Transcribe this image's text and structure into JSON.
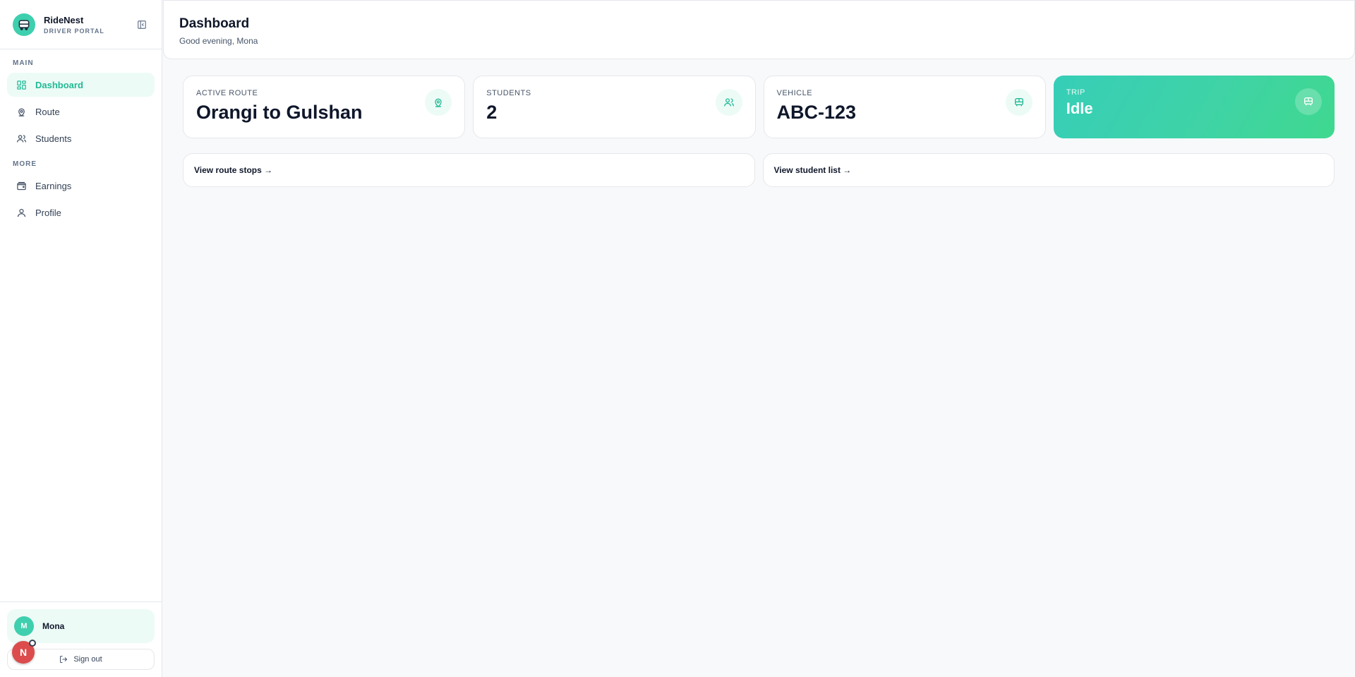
{
  "brand": {
    "name": "RideNest",
    "subtitle": "DRIVER PORTAL"
  },
  "nav": {
    "sections": [
      {
        "heading": "MAIN",
        "items": [
          {
            "label": "Dashboard",
            "icon": "dashboard-icon",
            "active": true
          },
          {
            "label": "Route",
            "icon": "map-pin-icon"
          },
          {
            "label": "Students",
            "icon": "users-icon"
          }
        ]
      },
      {
        "heading": "MORE",
        "items": [
          {
            "label": "Earnings",
            "icon": "wallet-icon"
          },
          {
            "label": "Profile",
            "icon": "user-icon"
          }
        ]
      }
    ]
  },
  "user": {
    "initial": "M",
    "name": "Mona"
  },
  "signout_label": "Sign out",
  "float_badge": {
    "letter": "N"
  },
  "header": {
    "title": "Dashboard",
    "subtitle": "Good evening, Mona"
  },
  "stats": [
    {
      "label": "ACTIVE ROUTE",
      "value": "Orangi to Gulshan",
      "icon": "map-pin-icon"
    },
    {
      "label": "STUDENTS",
      "value": "2",
      "icon": "users-icon"
    },
    {
      "label": "VEHICLE",
      "value": "ABC-123",
      "icon": "bus-icon"
    },
    {
      "label": "TRIP",
      "value": "Idle",
      "icon": "bus-icon"
    }
  ],
  "links": {
    "route_stops": "View route stops →",
    "student_list": "View student list →"
  },
  "colors": {
    "accent": "#22b995",
    "accent_light": "#ecfbf6",
    "trip_gradient_start": "#36ceb8",
    "trip_gradient_end": "#3fd88f"
  }
}
